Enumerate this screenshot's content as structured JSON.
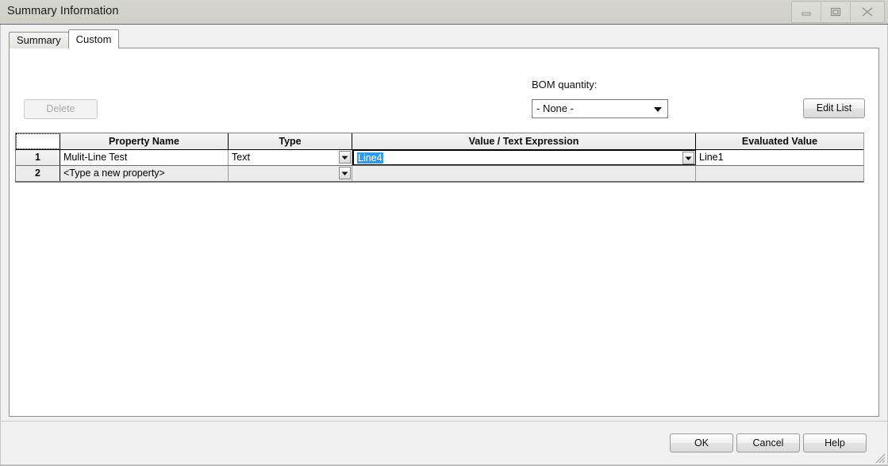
{
  "window": {
    "title": "Summary Information",
    "controls": [
      {
        "name": "minimize",
        "icon": "minimize-icon",
        "enabled": false
      },
      {
        "name": "restore",
        "icon": "restore-icon",
        "enabled": false
      },
      {
        "name": "close",
        "icon": "close-icon",
        "enabled": false
      }
    ]
  },
  "tabs": [
    {
      "label": "Summary",
      "active": false
    },
    {
      "label": "Custom",
      "active": true
    }
  ],
  "toolbar": {
    "delete_label": "Delete",
    "delete_enabled": false,
    "bom_label": "BOM quantity:",
    "bom_value": "- None -",
    "edit_list_label": "Edit List"
  },
  "grid": {
    "columns": [
      "",
      "Property Name",
      "Type",
      "Value / Text Expression",
      "Evaluated Value"
    ],
    "rows": [
      {
        "num": "1",
        "property_name": "Mulit-Line Test",
        "type": "Text",
        "value_expression": "Line4",
        "evaluated_value": "Line1",
        "selected": true
      },
      {
        "num": "2",
        "property_name": "<Type a new property>",
        "type": "",
        "value_expression": "",
        "evaluated_value": "",
        "selected": false
      }
    ]
  },
  "footer": {
    "ok_label": "OK",
    "cancel_label": "Cancel",
    "help_label": "Help"
  },
  "colors": {
    "titlebar": "#d2d2cb",
    "selection": "#2e9bf0",
    "panel": "#f0f0f0",
    "grid_alt_row": "#ececec"
  }
}
